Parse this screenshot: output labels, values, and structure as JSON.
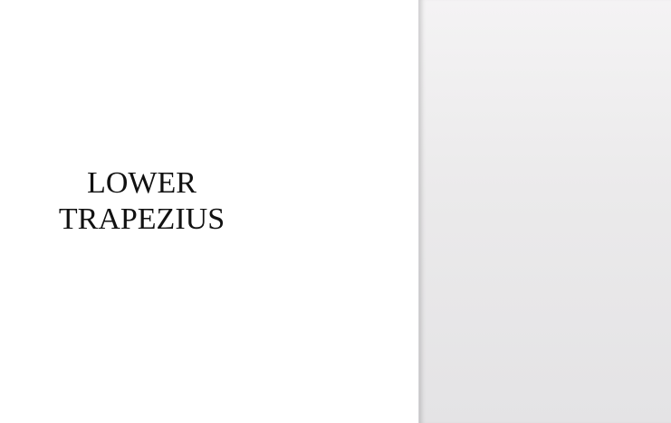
{
  "card": {
    "term_line1": "LOWER",
    "term_line2": "TRAPEZIUS"
  },
  "colors": {
    "card_background": "#ffffff",
    "panel_background": "#ebeaeb",
    "text": "#111111"
  }
}
